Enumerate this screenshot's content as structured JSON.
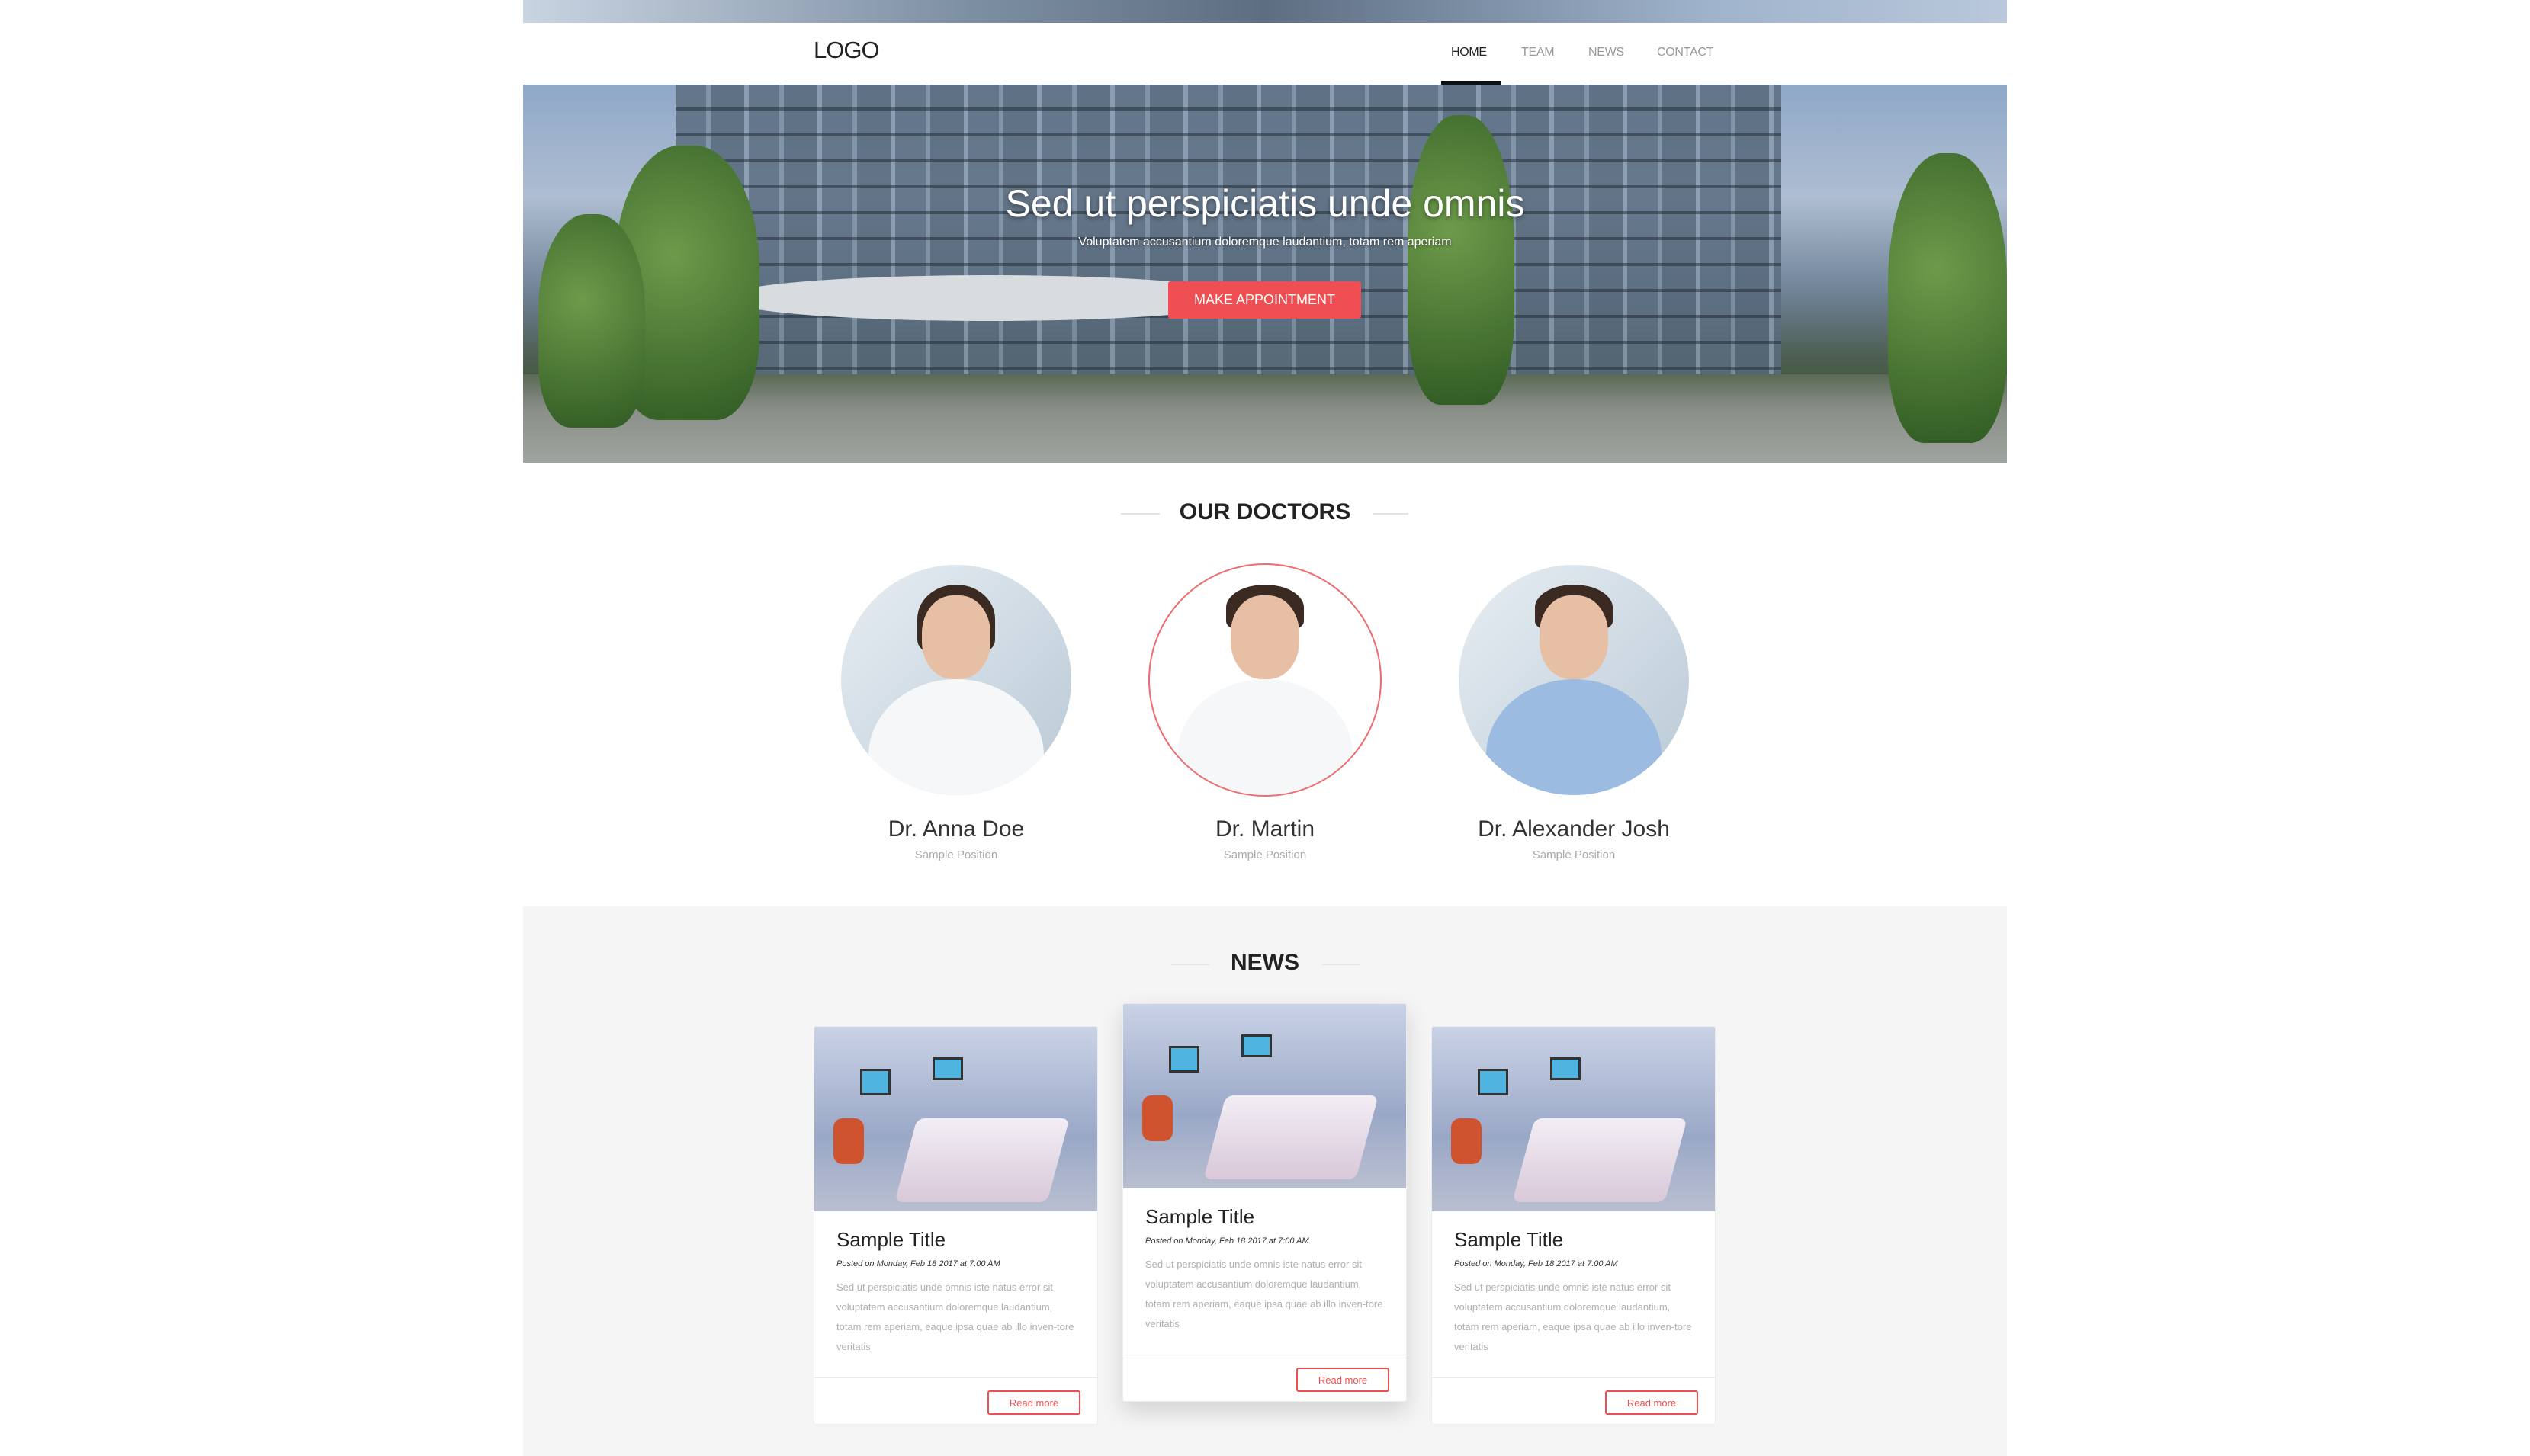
{
  "header": {
    "logo": "LOGO",
    "nav": [
      {
        "label": "HOME",
        "active": true
      },
      {
        "label": "TEAM"
      },
      {
        "label": "NEWS"
      },
      {
        "label": "CONTACT"
      }
    ]
  },
  "hero": {
    "title": "Sed ut perspiciatis unde omnis",
    "subtitle": "Voluptatem accusantium doloremque laudantium, totam rem aperiam",
    "button": "MAKE APPOINTMENT"
  },
  "doctors": {
    "title": "OUR DOCTORS",
    "items": [
      {
        "name": "Dr. Anna Doe",
        "position": "Sample Position"
      },
      {
        "name": "Dr. Martin",
        "position": "Sample Position"
      },
      {
        "name": "Dr. Alexander Josh",
        "position": "Sample Position"
      }
    ]
  },
  "news": {
    "title": "NEWS",
    "items": [
      {
        "title": "Sample Title",
        "date": "Posted on Monday, Feb 18 2017 at 7:00 AM",
        "body": "Sed ut perspiciatis unde omnis iste natus error sit voluptatem accusantium doloremque laudantium, totam rem aperiam, eaque ipsa quae ab illo inven-tore veritatis",
        "button": "Read more"
      },
      {
        "title": "Sample Title",
        "date": "Posted on Monday, Feb 18 2017 at 7:00 AM",
        "body": "Sed ut perspiciatis unde omnis iste natus error sit voluptatem accusantium doloremque laudantium, totam rem aperiam, eaque ipsa quae ab illo inven-tore veritatis",
        "button": "Read more"
      },
      {
        "title": "Sample Title",
        "date": "Posted on Monday, Feb 18 2017 at 7:00 AM",
        "body": "Sed ut perspiciatis unde omnis iste natus error sit voluptatem accusantium doloremque laudantium, totam rem aperiam, eaque ipsa quae ab illo inven-tore veritatis",
        "button": "Read more"
      }
    ]
  },
  "colors": {
    "accent": "#ef4f52",
    "news_bg": "#f5f5f5"
  }
}
